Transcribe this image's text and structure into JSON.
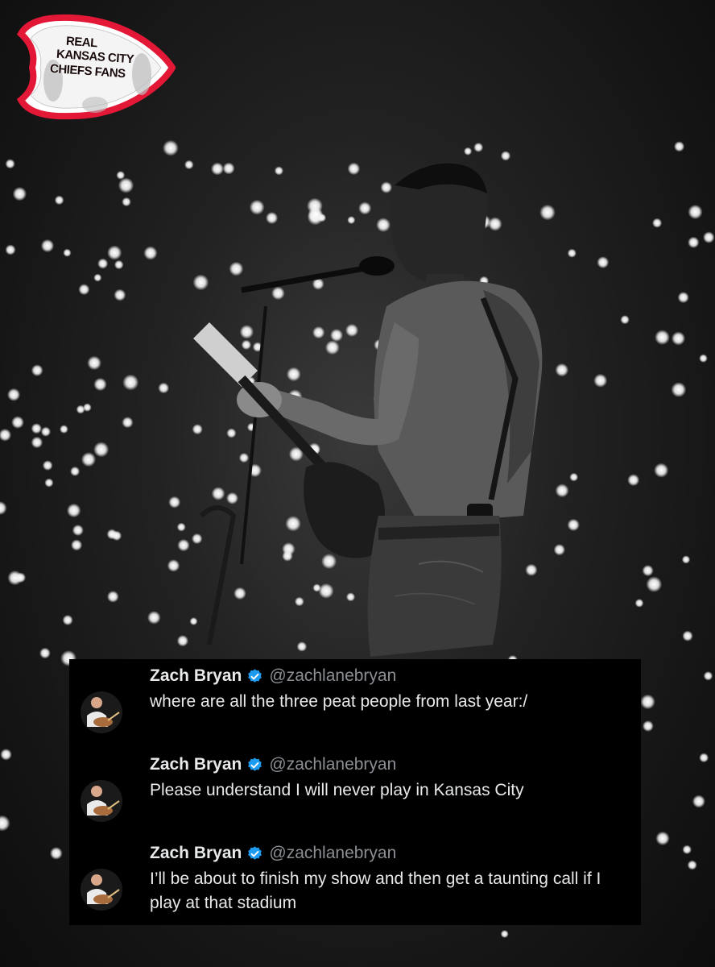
{
  "logo": {
    "lines": [
      "REAL",
      "KANSAS CITY",
      "CHIEFS FANS"
    ],
    "colors": {
      "red": "#e31837",
      "gold": "#ffb81c"
    }
  },
  "colors": {
    "card_bg": "#000000",
    "name_text": "#e7e9ea",
    "handle_text": "#8b8f93",
    "verified_blue": "#1d9bf0"
  },
  "tweets": [
    {
      "name": "Zach Bryan",
      "verified_icon": "verified-badge",
      "handle": "@zachlanebryan",
      "text": "where are all the three peat people from last year:/"
    },
    {
      "name": "Zach Bryan",
      "verified_icon": "verified-badge",
      "handle": "@zachlanebryan",
      "text": "Please understand I will never play in Kansas City"
    },
    {
      "name": "Zach Bryan",
      "verified_icon": "verified-badge",
      "handle": "@zachlanebryan",
      "text": "I’ll be about to finish my show and then get a taunting call if I play at that stadium"
    }
  ]
}
